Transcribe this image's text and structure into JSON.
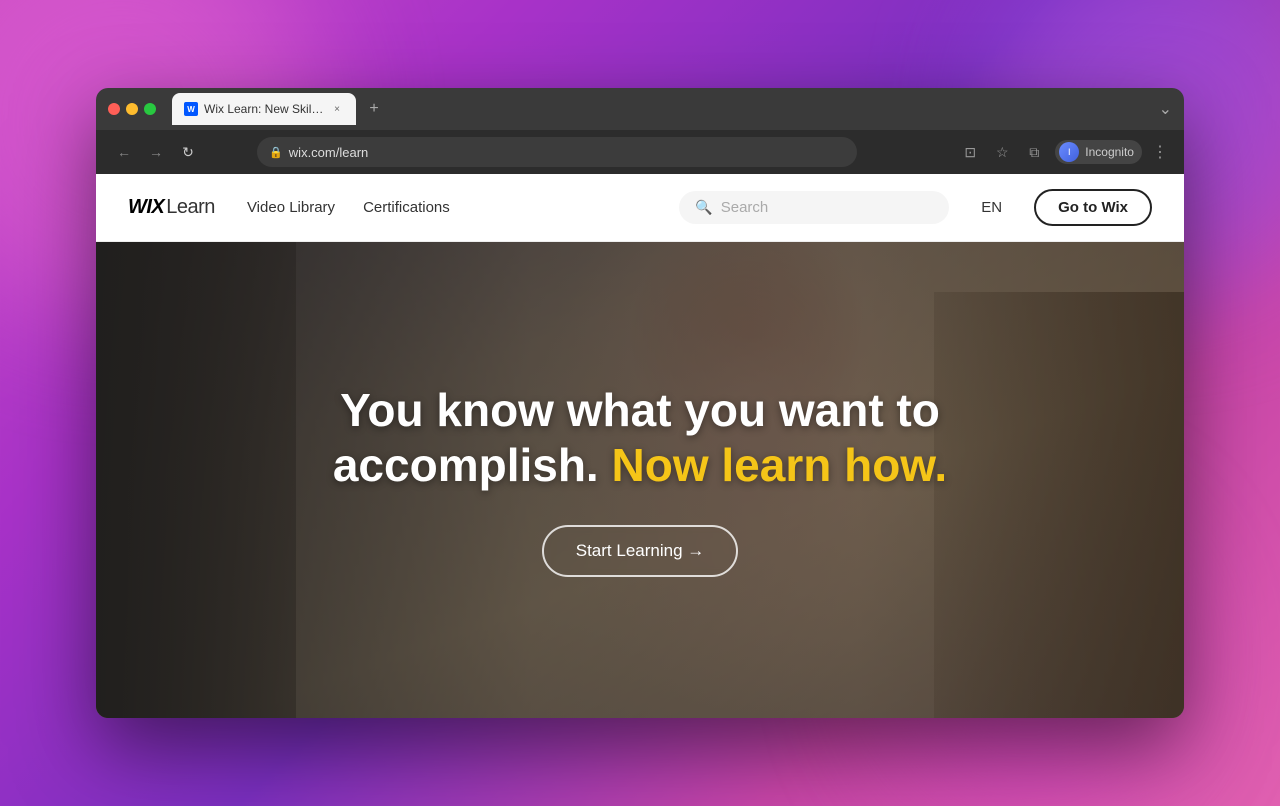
{
  "background": {
    "colors": [
      "#c84bc4",
      "#a832c8",
      "#7b2fc0",
      "#c845a8"
    ]
  },
  "browser": {
    "tab": {
      "favicon_label": "W",
      "title": "Wix Learn: New Skills To Boos...",
      "close_icon": "×",
      "new_tab_icon": "+"
    },
    "addressbar": {
      "back_icon": "←",
      "forward_icon": "→",
      "refresh_icon": "↻",
      "url": "wix.com/learn",
      "lock_icon": "🔒",
      "cast_icon": "⊡",
      "bookmark_icon": "☆",
      "split_icon": "⧉",
      "profile_label": "Incognito",
      "more_icon": "⋮",
      "expand_icon": "⌄"
    }
  },
  "site": {
    "logo": {
      "wix": "WIX",
      "learn": "Learn"
    },
    "nav": {
      "links": [
        "Video Library",
        "Certifications"
      ]
    },
    "search": {
      "placeholder": "Search"
    },
    "language": "EN",
    "goto_button": "Go to Wix"
  },
  "hero": {
    "headline_part1": "You know what you want to accomplish.",
    "headline_accent": " Now learn how.",
    "cta_label": "Start Learning →"
  }
}
